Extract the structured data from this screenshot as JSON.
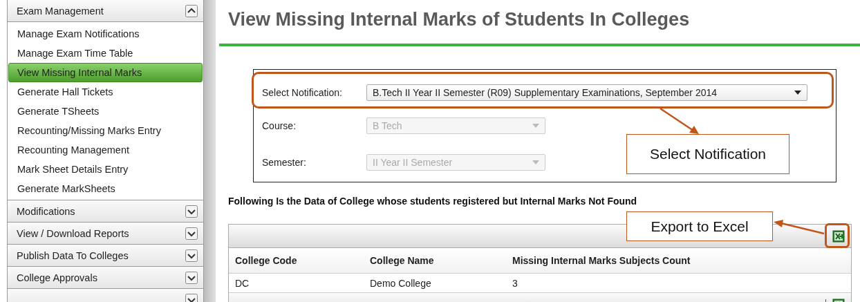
{
  "sidebar": {
    "sections": [
      {
        "title": "Exam Management",
        "expanded": true,
        "items": [
          {
            "label": "Manage Exam Notifications",
            "selected": false
          },
          {
            "label": "Manage Exam Time Table",
            "selected": false
          },
          {
            "label": "View Missing Internal Marks",
            "selected": true
          },
          {
            "label": "Generate Hall Tickets",
            "selected": false
          },
          {
            "label": "Generate TSheets",
            "selected": false
          },
          {
            "label": "Recounting/Missing Marks Entry",
            "selected": false
          },
          {
            "label": "Recounting Management",
            "selected": false
          },
          {
            "label": "Mark Sheet Details Entry",
            "selected": false
          },
          {
            "label": "Generate MarkSheets",
            "selected": false
          }
        ]
      },
      {
        "title": "Modifications",
        "expanded": false
      },
      {
        "title": "View / Download Reports",
        "expanded": false
      },
      {
        "title": "Publish Data To Colleges",
        "expanded": false
      },
      {
        "title": "College Approvals",
        "expanded": false
      },
      {
        "expanded": false
      }
    ]
  },
  "page_title": "View Missing Internal Marks of Students In Colleges",
  "form": {
    "fields": [
      {
        "label": "Select Notification:",
        "value": "B.Tech II Year II Semester (R09) Supplementary Examinations, September 2014",
        "disabled": false
      },
      {
        "label": "Course:",
        "value": "B Tech",
        "disabled": true
      },
      {
        "label": "Semester:",
        "value": "II Year II Semester",
        "disabled": true
      }
    ]
  },
  "section_heading": "Following Is the Data of College whose students registered but Internal Marks Not Found",
  "table": {
    "columns": [
      "College Code",
      "College Name",
      "Missing Internal Marks Subjects Count"
    ],
    "rows": [
      [
        "DC",
        "Demo College",
        "3"
      ]
    ]
  },
  "annotations": [
    {
      "kind": "notification",
      "text": "Select Notification"
    },
    {
      "kind": "export",
      "text": "Export to Excel"
    }
  ]
}
